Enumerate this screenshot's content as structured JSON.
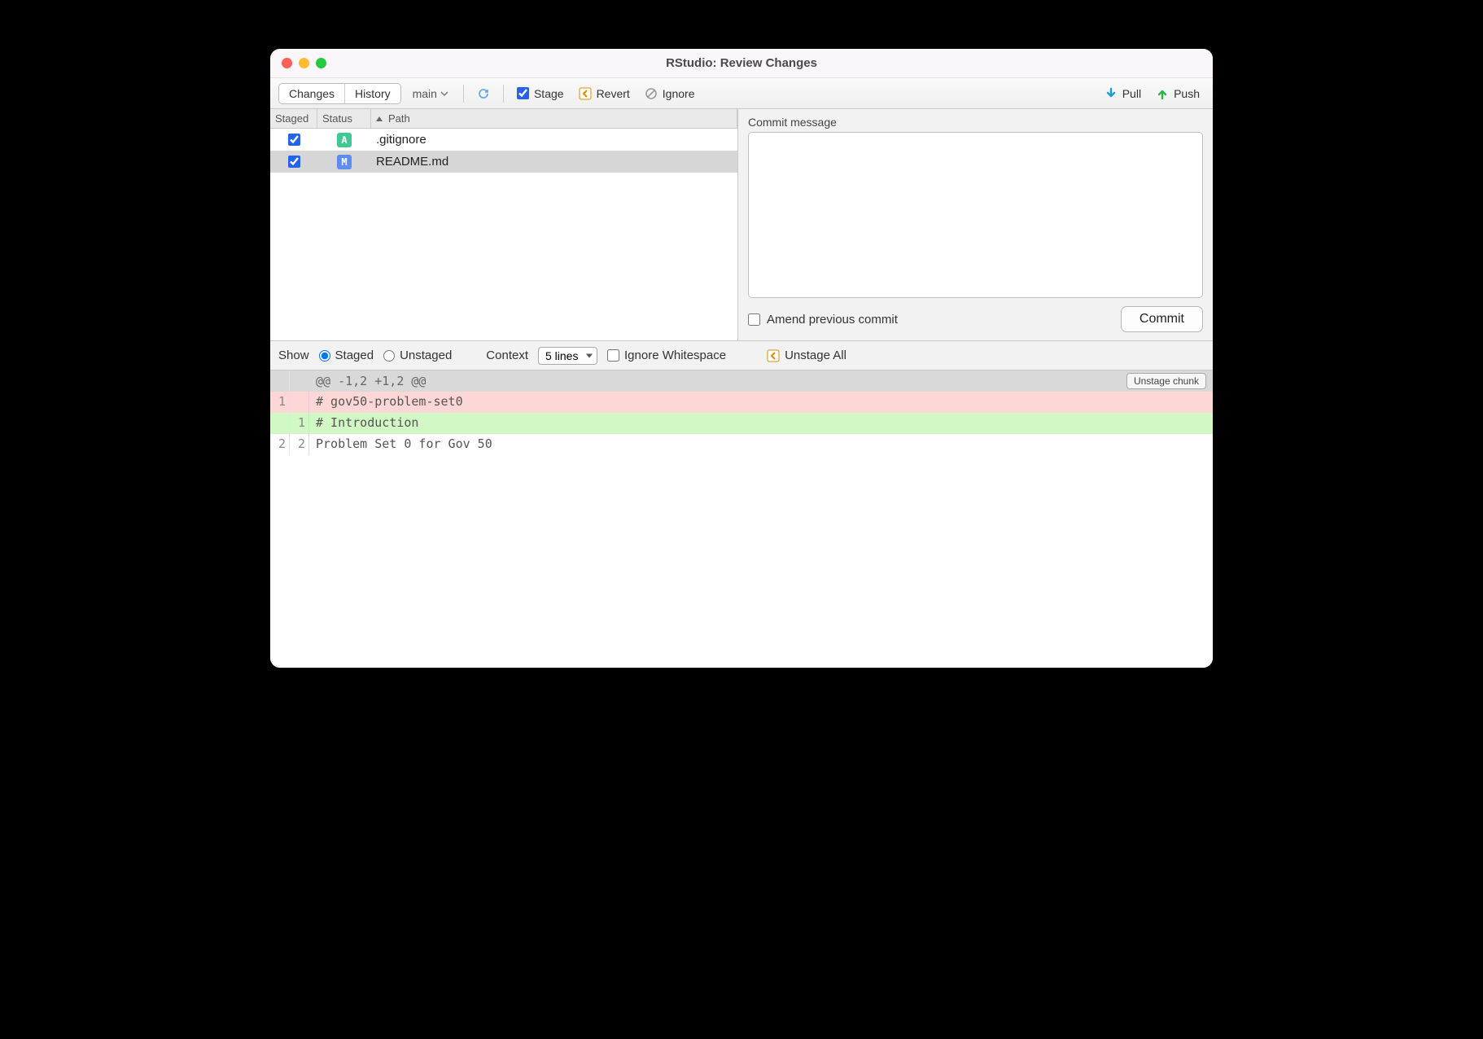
{
  "window": {
    "title": "RStudio: Review Changes"
  },
  "toolbar": {
    "tabs": {
      "changes": "Changes",
      "history": "History"
    },
    "branch": "main",
    "stage": "Stage",
    "revert": "Revert",
    "ignore": "Ignore",
    "pull": "Pull",
    "push": "Push"
  },
  "files": {
    "headers": {
      "staged": "Staged",
      "status": "Status",
      "path": "Path"
    },
    "rows": [
      {
        "staged": true,
        "status": "A",
        "path": ".gitignore",
        "selected": false
      },
      {
        "staged": true,
        "status": "M",
        "path": "README.md",
        "selected": true
      }
    ]
  },
  "commit": {
    "label": "Commit message",
    "value": "",
    "amend": "Amend previous commit",
    "button": "Commit"
  },
  "diffbar": {
    "show": "Show",
    "staged": "Staged",
    "unstaged": "Unstaged",
    "context": "Context",
    "context_value": "5 lines",
    "ignore_ws": "Ignore Whitespace",
    "unstage_all": "Unstage All"
  },
  "diff": {
    "hunk_header": "@@ -1,2 +1,2 @@",
    "unstage_chunk": "Unstage chunk",
    "lines": [
      {
        "old": "1",
        "new": "",
        "kind": "del",
        "text": "# gov50-problem-set0"
      },
      {
        "old": "",
        "new": "1",
        "kind": "add",
        "text": "# Introduction"
      },
      {
        "old": "2",
        "new": "2",
        "kind": "ctx",
        "text": "Problem Set 0 for Gov 50"
      }
    ]
  }
}
